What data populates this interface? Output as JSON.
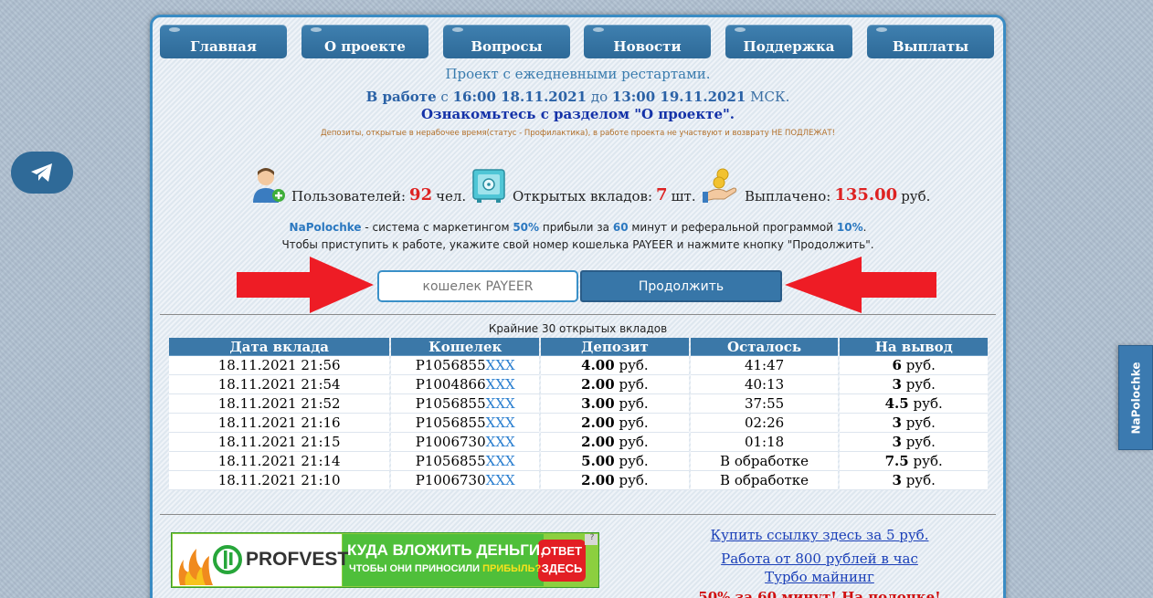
{
  "nav": {
    "items": [
      "Главная",
      "О проекте",
      "Вопросы",
      "Новости",
      "Поддержка",
      "Выплаты"
    ]
  },
  "header": {
    "restart_text": "Проект с ежедневными рестартами.",
    "work_label": "В работе",
    "work_from_prefix": "с",
    "work_from": "16:00 18.11.2021",
    "work_to_prefix": "до",
    "work_to": "13:00 19.11.2021",
    "work_tz": "МСК.",
    "about_text": "Ознакомьтесь с разделом \"О проекте\".",
    "notice_text": "Депозиты, открытые в нерабочее время(статус - Профилактика), в работе проекта не участвуют и возврату НЕ ПОДЛЕЖАТ!"
  },
  "stats": {
    "users_label": "Пользователей:",
    "users_value": "92",
    "users_unit": "чел.",
    "deposits_label": "Открытых вкладов:",
    "deposits_value": "7",
    "deposits_unit": "шт.",
    "paid_label": "Выплачено:",
    "paid_value": "135.00",
    "paid_unit": "руб."
  },
  "marketing": {
    "brand": "NaPolochke",
    "text1": " - система с маркетингом ",
    "percent": "50%",
    "text2": " прибыли за ",
    "minutes": "60",
    "text3": " минут и реферальной программой ",
    "ref_percent": "10%",
    "text4": ".",
    "instruction": "Чтобы приступить к работе, укажите свой номер кошелька PAYEER и нажмите кнопку \"Продолжить\"."
  },
  "form": {
    "wallet_placeholder": "кошелек PAYEER",
    "continue_label": "Продолжить"
  },
  "deposits": {
    "title": "Крайние 30 открытых вкладов",
    "columns": [
      "Дата вклада",
      "Кошелек",
      "Депозит",
      "Осталось",
      "На вывод"
    ],
    "rows": [
      {
        "date": "18.11.2021 21:56",
        "wallet": "P1056855",
        "mask": "XXX",
        "deposit": "4.00",
        "cur": "руб.",
        "left": "41:47",
        "payout": "6",
        "pcur": "руб."
      },
      {
        "date": "18.11.2021 21:54",
        "wallet": "P1004866",
        "mask": "XXX",
        "deposit": "2.00",
        "cur": "руб.",
        "left": "40:13",
        "payout": "3",
        "pcur": "руб."
      },
      {
        "date": "18.11.2021 21:52",
        "wallet": "P1056855",
        "mask": "XXX",
        "deposit": "3.00",
        "cur": "руб.",
        "left": "37:55",
        "payout": "4.5",
        "pcur": "руб."
      },
      {
        "date": "18.11.2021 21:16",
        "wallet": "P1056855",
        "mask": "XXX",
        "deposit": "2.00",
        "cur": "руб.",
        "left": "02:26",
        "payout": "3",
        "pcur": "руб."
      },
      {
        "date": "18.11.2021 21:15",
        "wallet": "P1006730",
        "mask": "XXX",
        "deposit": "2.00",
        "cur": "руб.",
        "left": "01:18",
        "payout": "3",
        "pcur": "руб."
      },
      {
        "date": "18.11.2021 21:14",
        "wallet": "P1056855",
        "mask": "XXX",
        "deposit": "5.00",
        "cur": "руб.",
        "left": "В обработке",
        "payout": "7.5",
        "pcur": "руб."
      },
      {
        "date": "18.11.2021 21:10",
        "wallet": "P1006730",
        "mask": "XXX",
        "deposit": "2.00",
        "cur": "руб.",
        "left": "В обработке",
        "payout": "3",
        "pcur": "руб."
      }
    ]
  },
  "banner": {
    "brand": "PROFVEST",
    "headline": "КУДА ВЛОЖИТЬ ДЕНЬГИ,",
    "subline_a": "ЧТОБЫ ОНИ ПРИНОСИЛИ ",
    "subline_b": "ПРИБЫЛЬ?",
    "badge_line1": "ОТВЕТ",
    "badge_line2": "ЗДЕСЬ",
    "help": "?"
  },
  "ads": {
    "link1": "Купить ссылку здесь за 5 руб.",
    "link2": "Работа от 800 рублей в час",
    "link3": "Турбо майнинг",
    "link4": "50% за 60 минут! На полочке!"
  },
  "side_tab": {
    "label": "NaPolochke"
  },
  "colors": {
    "accent": "#3b78a8",
    "highlight_red": "#dd2222",
    "link_blue": "#1a3fb8"
  }
}
